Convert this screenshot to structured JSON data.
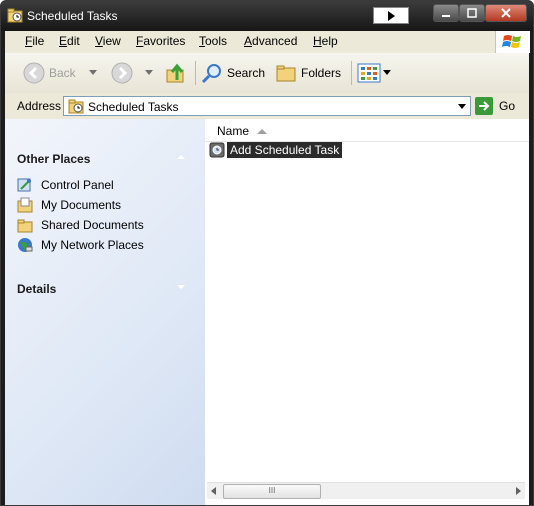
{
  "window": {
    "title": "Scheduled Tasks"
  },
  "menu": {
    "items": [
      {
        "label": "File",
        "u": "F",
        "rest": "ile"
      },
      {
        "label": "Edit",
        "u": "E",
        "rest": "dit"
      },
      {
        "label": "View",
        "u": "V",
        "rest": "iew"
      },
      {
        "label": "Favorites",
        "u": "F",
        "rest": "avorites"
      },
      {
        "label": "Tools",
        "u": "T",
        "rest": "ools"
      },
      {
        "label": "Advanced",
        "u": "A",
        "rest": "dvanced"
      },
      {
        "label": "Help",
        "u": "H",
        "rest": "elp"
      }
    ]
  },
  "toolbar": {
    "back_label": "Back",
    "search_label": "Search",
    "folders_label": "Folders"
  },
  "address": {
    "label": "Address",
    "value": "Scheduled Tasks",
    "go_label": "Go"
  },
  "sidebar": {
    "other_places_title": "Other Places",
    "places": [
      {
        "label": "Control Panel",
        "icon": "control-panel-icon"
      },
      {
        "label": "My Documents",
        "icon": "my-documents-icon"
      },
      {
        "label": "Shared Documents",
        "icon": "shared-documents-icon"
      },
      {
        "label": "My Network Places",
        "icon": "network-places-icon"
      }
    ],
    "details_title": "Details"
  },
  "list": {
    "column_name": "Name",
    "items": [
      {
        "label": "Add Scheduled Task",
        "icon": "add-task-icon",
        "selected": true
      }
    ]
  },
  "scrollbar": {
    "thumb_grip": "III"
  },
  "colors": {
    "titlebar": "#1d1d1d",
    "sidebar": "#dfe8f6",
    "selection": "#2b2b2b",
    "go_green": "#3a9a3a"
  }
}
